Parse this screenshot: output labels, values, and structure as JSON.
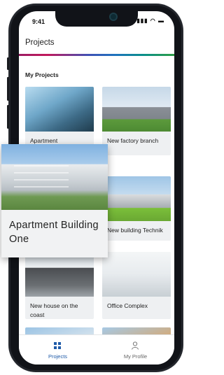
{
  "status": {
    "time": "9:41",
    "icons": "▮▮▮ ◠ ▬"
  },
  "appbar": {
    "title": "Projects"
  },
  "section": {
    "title": "My Projects"
  },
  "projects": [
    {
      "label": "Apartment",
      "image": "apartment-photo"
    },
    {
      "label": "New factory branch",
      "image": "factory-photo"
    },
    {
      "label": "",
      "image": "building-photo"
    },
    {
      "label": "New building Technik",
      "image": "building-photo"
    },
    {
      "label": "New house on the coast",
      "image": "house-photo"
    },
    {
      "label": "Office Complex",
      "image": "office-photo"
    }
  ],
  "popup": {
    "label": "Apartment Building One"
  },
  "tabs": [
    {
      "label": "Projects",
      "icon": "grid-icon",
      "active": true
    },
    {
      "label": "My Profile",
      "icon": "person-icon",
      "active": false
    }
  ],
  "colors": {
    "accent": "#1e5aa8"
  }
}
